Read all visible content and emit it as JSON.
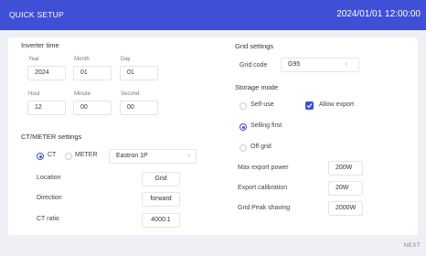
{
  "header": {
    "title": "QUICK SETUP",
    "datetime": "2024/01/01 12:00:00"
  },
  "inverter_time": {
    "title": "Inverter time",
    "labels": {
      "year": "Year",
      "month": "Month",
      "day": "Day",
      "hour": "Hour",
      "minute": "Minute",
      "second": "Second"
    },
    "values": {
      "year": "2024",
      "month": "01",
      "day": "01",
      "hour": "12",
      "minute": "00",
      "second": "00"
    }
  },
  "ct_meter": {
    "title": "CT/METER settings",
    "ct_label": "CT",
    "meter_label": "METER",
    "selected": "CT",
    "meter_model": "Eastron 1P",
    "location_label": "Location",
    "location_value": "Grid",
    "direction_label": "Direction",
    "direction_value": "forward",
    "ct_ratio_label": "CT ratio",
    "ct_ratio_value": "4000:1"
  },
  "grid": {
    "title": "Grid settings",
    "code_label": "Grid code",
    "code_value": "G95"
  },
  "storage": {
    "title": "Storage mode",
    "self_use": "Self-use",
    "allow_export": "Allow export",
    "allow_export_checked": true,
    "selling_first": "Selling first",
    "off_grid": "Off grid",
    "selected": "Selling first"
  },
  "export": {
    "max_power_label": "Max export power",
    "max_power_value": "200W",
    "calibration_label": "Export calibration",
    "calibration_value": "20W",
    "peak_shaving_label": "Grid Peak shaving",
    "peak_shaving_value": "2000W"
  },
  "footer": {
    "next_label": "NEXT"
  },
  "colors": {
    "accent": "#3f4fd6",
    "background": "#eef0f5",
    "panel": "#ffffff"
  }
}
